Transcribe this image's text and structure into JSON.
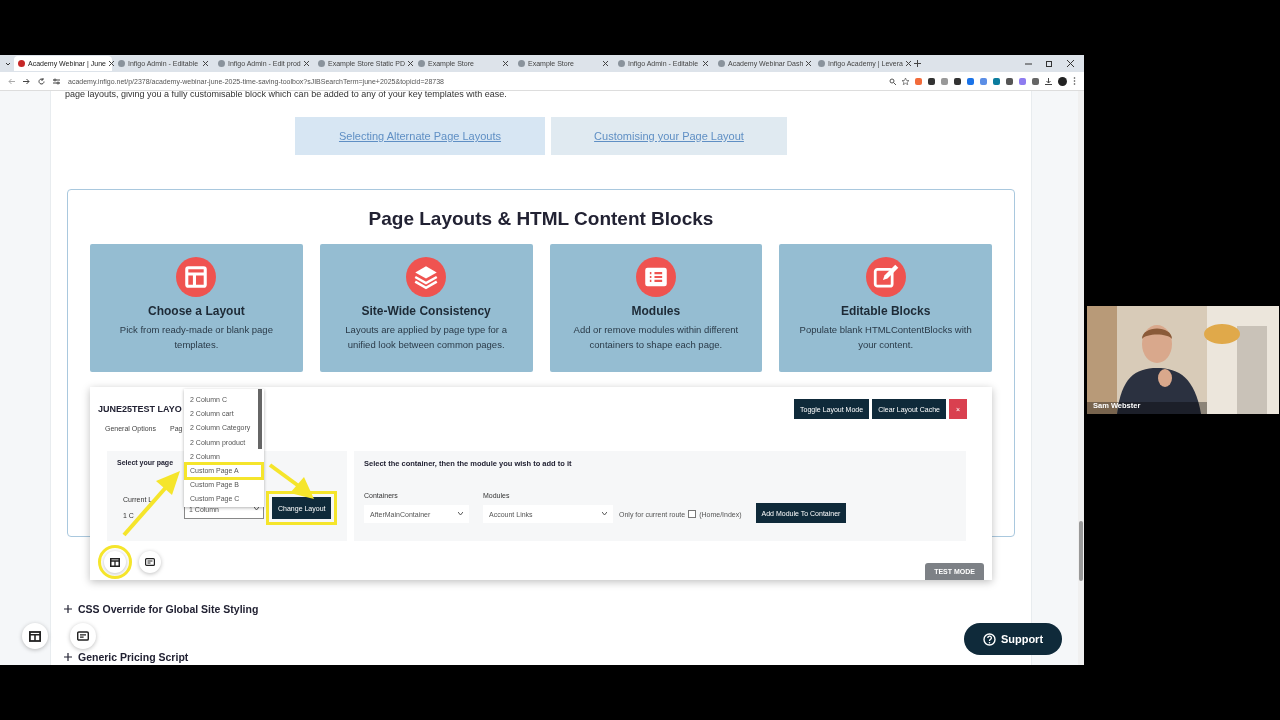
{
  "browser": {
    "tabs": [
      {
        "title": "Academy Webinar | June",
        "selected": true
      },
      {
        "title": "Infigo Admin - Editable",
        "selected": false
      },
      {
        "title": "Infigo Admin - Edit prod",
        "selected": false
      },
      {
        "title": "Example Store Static PD",
        "selected": false
      },
      {
        "title": "Example Store",
        "selected": false
      },
      {
        "title": "Example Store",
        "selected": false
      },
      {
        "title": "Infigo Admin - Editable",
        "selected": false
      },
      {
        "title": "Academy Webinar Dash",
        "selected": false
      },
      {
        "title": "Infigo Academy | Levera",
        "selected": false
      }
    ],
    "url": "academy.infigo.net/p/2378/academy-webinar-june-2025-time-saving-toolbox?sJIBSearchTerm=june+2025&topicid=28738"
  },
  "page": {
    "intro": "page layouts, giving you a fully customisable block which can be added to any of your key templates with ease.",
    "buttons": [
      "Selecting Alternate Page Layouts",
      "Customising your Page Layout"
    ],
    "section": {
      "title": "Page Layouts & HTML Content Blocks",
      "cards": [
        {
          "title": "Choose a Layout",
          "text": "Pick from ready-made or blank page templates."
        },
        {
          "title": "Site-Wide Consistency",
          "text": "Layouts are applied by page type for a unified look between common pages."
        },
        {
          "title": "Modules",
          "text": "Add or remove modules within different containers to shape each page."
        },
        {
          "title": "Editable Blocks",
          "text": "Populate blank HTMLContentBlocks with your content."
        }
      ]
    }
  },
  "editor": {
    "title": "JUNE25TEST LAYO",
    "tabs": [
      "General Options",
      "Pag"
    ],
    "actions": [
      {
        "label": "Toggle Layout Mode",
        "kind": "primary"
      },
      {
        "label": "Clear Layout Cache",
        "kind": "primary"
      },
      {
        "label": "×",
        "kind": "danger"
      }
    ],
    "layout_panel": {
      "heading": "Select your page",
      "current_label": "Current L",
      "current_value": "1 C",
      "select_value": "1 Column",
      "button": "Change Layout",
      "options": [
        {
          "label": "2 Column C",
          "highlighted": false
        },
        {
          "label": "2 Column cart",
          "highlighted": false
        },
        {
          "label": "2 Column Category",
          "highlighted": false
        },
        {
          "label": "2 Column product",
          "highlighted": false
        },
        {
          "label": "2 Column",
          "highlighted": false
        },
        {
          "label": "Custom Page A",
          "highlighted": true
        },
        {
          "label": "Custom Page B",
          "highlighted": false
        },
        {
          "label": "Custom Page C",
          "highlighted": false
        }
      ]
    },
    "module_panel": {
      "heading": "Select the container, then the module you wish to add to it",
      "containers_label": "Containers",
      "containers_value": "AfterMainContainer",
      "modules_label": "Modules",
      "modules_value": "Account Links",
      "route_label": "Only for current route",
      "route_checked": false,
      "route_note": "(Home/Index)",
      "button": "Add Module To Container"
    },
    "badge": "TEST MODE"
  },
  "accordion": [
    {
      "label": "CSS Override for Global Site Styling",
      "expanded": false
    },
    {
      "label": "Generic Pricing Script",
      "expanded": false
    }
  ],
  "support": "Support",
  "video": {
    "name": "Sam Webster"
  }
}
